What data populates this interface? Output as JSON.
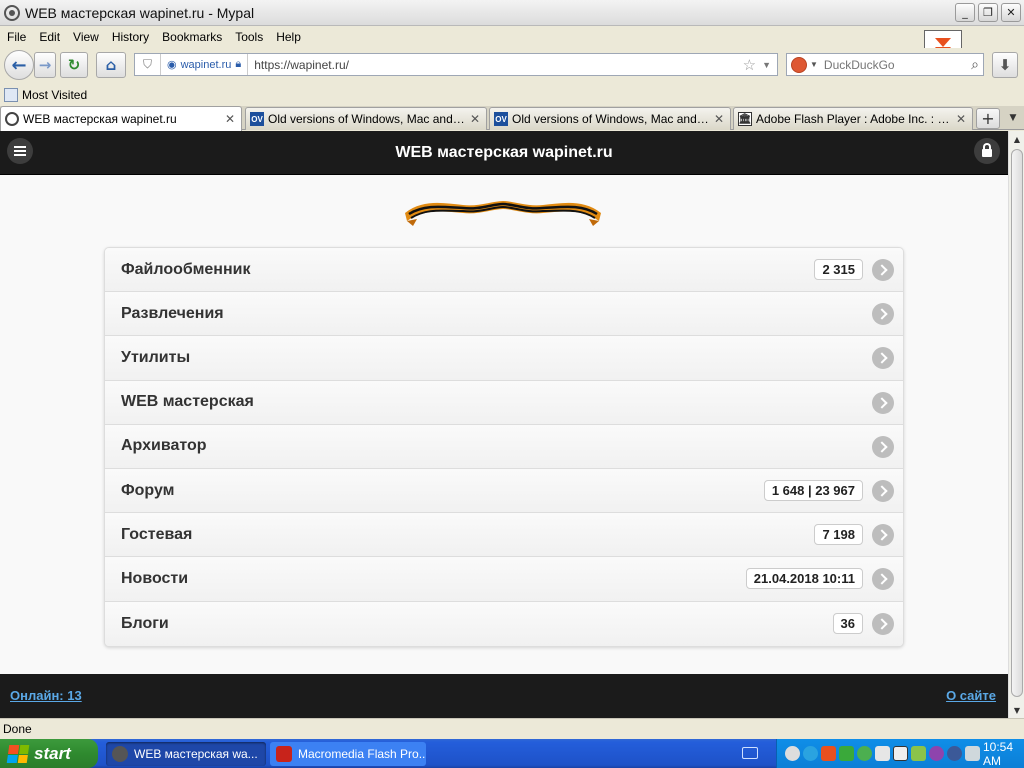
{
  "window": {
    "title": "WEB мастерская wapinet.ru - Mypal"
  },
  "menu": [
    "File",
    "Edit",
    "View",
    "History",
    "Bookmarks",
    "Tools",
    "Help"
  ],
  "nav": {
    "site_identity": "wapinet.ru",
    "url": "https://wapinet.ru/",
    "search_placeholder": "DuckDuckGo"
  },
  "bookmarks": {
    "most_visited": "Most Visited"
  },
  "tabs": [
    {
      "label": "WEB мастерская wapinet.ru",
      "icon": "eye-icon",
      "active": true
    },
    {
      "label": "Old versions of Windows, Mac and Linu...",
      "icon": "ov-icon",
      "active": false
    },
    {
      "label": "Old versions of Windows, Mac and Linu...",
      "icon": "ov-icon",
      "active": false
    },
    {
      "label": "Adobe Flash Player : Adobe Inc. : Free ...",
      "icon": "archive-icon",
      "active": false
    }
  ],
  "site": {
    "header_title": "WEB мастерская wapinet.ru",
    "items": [
      {
        "label": "Файлообменник",
        "count": "2 315"
      },
      {
        "label": "Развлечения",
        "count": ""
      },
      {
        "label": "Утилиты",
        "count": ""
      },
      {
        "label": "WEB мастерская",
        "count": ""
      },
      {
        "label": "Архиватор",
        "count": ""
      },
      {
        "label": "Форум",
        "count": "1 648 | 23 967"
      },
      {
        "label": "Гостевая",
        "count": "7 198"
      },
      {
        "label": "Новости",
        "count": "21.04.2018 10:11"
      },
      {
        "label": "Блоги",
        "count": "36"
      }
    ],
    "footer_online": "Онлайн: 13",
    "footer_about": "О сайте"
  },
  "status": {
    "text": "Done"
  },
  "taskbar": {
    "start_label": "start",
    "tasks": [
      {
        "label": "WEB мастерская wa...",
        "active": true
      },
      {
        "label": "Macromedia Flash Pro...",
        "active": false
      }
    ],
    "clock": "10:54 AM"
  },
  "colors": {
    "header_bg": "#1b1b1b",
    "link": "#5aa8e6",
    "taskbar": "#245edb",
    "start": "#2f8a2f"
  }
}
